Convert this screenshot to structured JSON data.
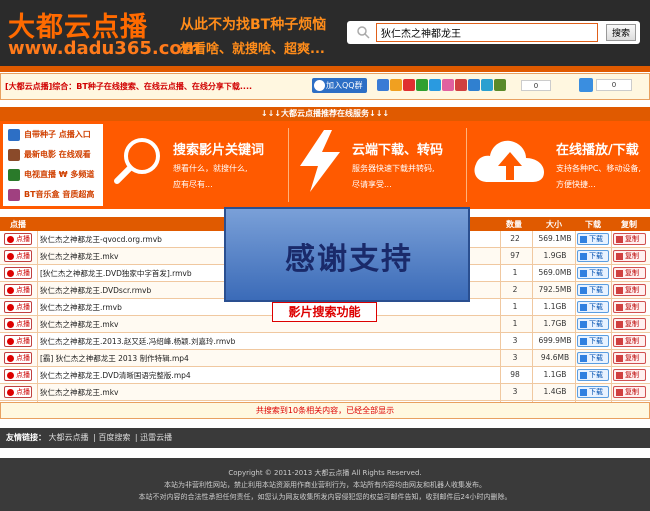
{
  "header": {
    "logo_text": "大都云点播",
    "logo_url": "www.dadu365.com",
    "slogan_line1": "从此不为找BT种子烦恼",
    "slogan_line2": "想看啥、就搜啥、超爽...",
    "search_value": "狄仁杰之神都龙王",
    "search_button": "搜索"
  },
  "notice": {
    "text": "[大都云点播]综合：BT种子在线搜索、在线云点播、在线分享下载....",
    "qq_button": "加入QQ群",
    "share_count": "0",
    "like_count": "0"
  },
  "services": {
    "bar_title": "↓↓↓大都云点播推荐在线服务↓↓↓",
    "menu": [
      {
        "label": "自带种子 点播入口",
        "color": "#2d6fc5"
      },
      {
        "label": "最新电影 在线观看",
        "color": "#8a4a2a"
      },
      {
        "label": "电视直播 ₩ 多频道",
        "color": "#2a7a2a"
      },
      {
        "label": "BT音乐盒 音质超高",
        "color": "#a04080"
      }
    ],
    "cards": [
      {
        "title": "搜索影片关键词",
        "desc1": "想看什么，就搜什么,",
        "desc2": "应有尽有..."
      },
      {
        "title": "云端下载、转码",
        "desc1": "服务器快速下载并转码,",
        "desc2": "尽请享受..."
      },
      {
        "title": "在线播放/下载",
        "desc1": "支持各种PC、移动设备,",
        "desc2": "方便快捷..."
      }
    ]
  },
  "table": {
    "headers": {
      "play": "点播",
      "count": "数量",
      "size": "大小",
      "download": "下载",
      "copy": "复制"
    },
    "play_label": "点播",
    "download_label": "下载",
    "copy_label": "复制",
    "rows": [
      {
        "title": "狄仁杰之神都龙王-qvocd.org.rmvb",
        "count": "22",
        "size": "569.1MB"
      },
      {
        "title": "狄仁杰之神都龙王.mkv",
        "count": "97",
        "size": "1.9GB"
      },
      {
        "title": "[狄仁杰之神都龙王.DVD独家中字首发].rmvb",
        "count": "1",
        "size": "569.0MB"
      },
      {
        "title": "狄仁杰之神都龙王.DVDscr.rmvb",
        "count": "2",
        "size": "792.5MB"
      },
      {
        "title": "狄仁杰之神都龙王.rmvb",
        "count": "1",
        "size": "1.1GB"
      },
      {
        "title": "狄仁杰之神都龙王.mkv",
        "count": "1",
        "size": "1.7GB"
      },
      {
        "title": "狄仁杰之神都龙王.2013.赵又廷.冯绍峰.杨颖.刘嘉玲.rmvb",
        "count": "3",
        "size": "699.9MB"
      },
      {
        "title": "[霸] 狄仁杰之神都龙王 2013 制作特辑.mp4",
        "count": "3",
        "size": "94.6MB"
      },
      {
        "title": "狄仁杰之神都龙王.DVD清晰国语完整版.mp4",
        "count": "98",
        "size": "1.1GB"
      },
      {
        "title": "狄仁杰之神都龙王.mkv",
        "count": "3",
        "size": "1.4GB"
      }
    ],
    "summary": "共搜索到10条相关内容，已经全部显示"
  },
  "overlay": {
    "title": "感谢支持",
    "subtitle": "影片搜索功能"
  },
  "friends": {
    "label": "友情链接：",
    "links": [
      "大都云点播",
      "百度搜索",
      "迅雷云播"
    ]
  },
  "footer": {
    "line1": "Copyright © 2011-2013 大都云点播 All Rights Reserved.",
    "line2": "本站为非营利性网站，禁止利用本站资源用作商业营利行为，本站所有内容均由网友和机器人收集发布。",
    "line3": "本站不对内容的合法性承担任何责任，如您认为网友收集所发内容侵犯您的权益可邮件告知，收到邮件后24小时内删除。"
  },
  "colors": {
    "brand_orange": "#ff5a00",
    "header_dark": "#2b2b2b",
    "notice_red": "#d00000"
  }
}
